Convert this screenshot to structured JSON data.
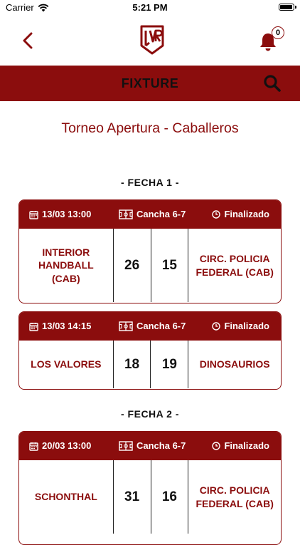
{
  "status": {
    "carrier": "Carrier",
    "time": "5:21 PM"
  },
  "header": {
    "notification_count": "0"
  },
  "title_bar": {
    "title": "FIXTURE"
  },
  "tournament": {
    "name": "Torneo Apertura - Caballeros"
  },
  "colors": {
    "accent": "#8b0d0d",
    "header_text": "#ffffff"
  },
  "fechas": [
    {
      "label": "- FECHA 1 -"
    },
    {
      "label": "- FECHA 2 -"
    }
  ],
  "matches": [
    {
      "date": "13/03 13:00",
      "court": "Cancha 6-7",
      "status": "Finalizado",
      "home": "INTERIOR HANDBALL (CAB)",
      "home_score": "26",
      "away_score": "15",
      "away": "CIRC. POLICIA FEDERAL (CAB)"
    },
    {
      "date": "13/03 14:15",
      "court": "Cancha 6-7",
      "status": "Finalizado",
      "home": "LOS VALORES",
      "home_score": "18",
      "away_score": "19",
      "away": "DINOSAURIOS"
    },
    {
      "date": "20/03 13:00",
      "court": "Cancha 6-7",
      "status": "Finalizado",
      "home": "SCHONTHAL",
      "home_score": "31",
      "away_score": "16",
      "away": "CIRC. POLICIA FEDERAL (CAB)"
    }
  ]
}
